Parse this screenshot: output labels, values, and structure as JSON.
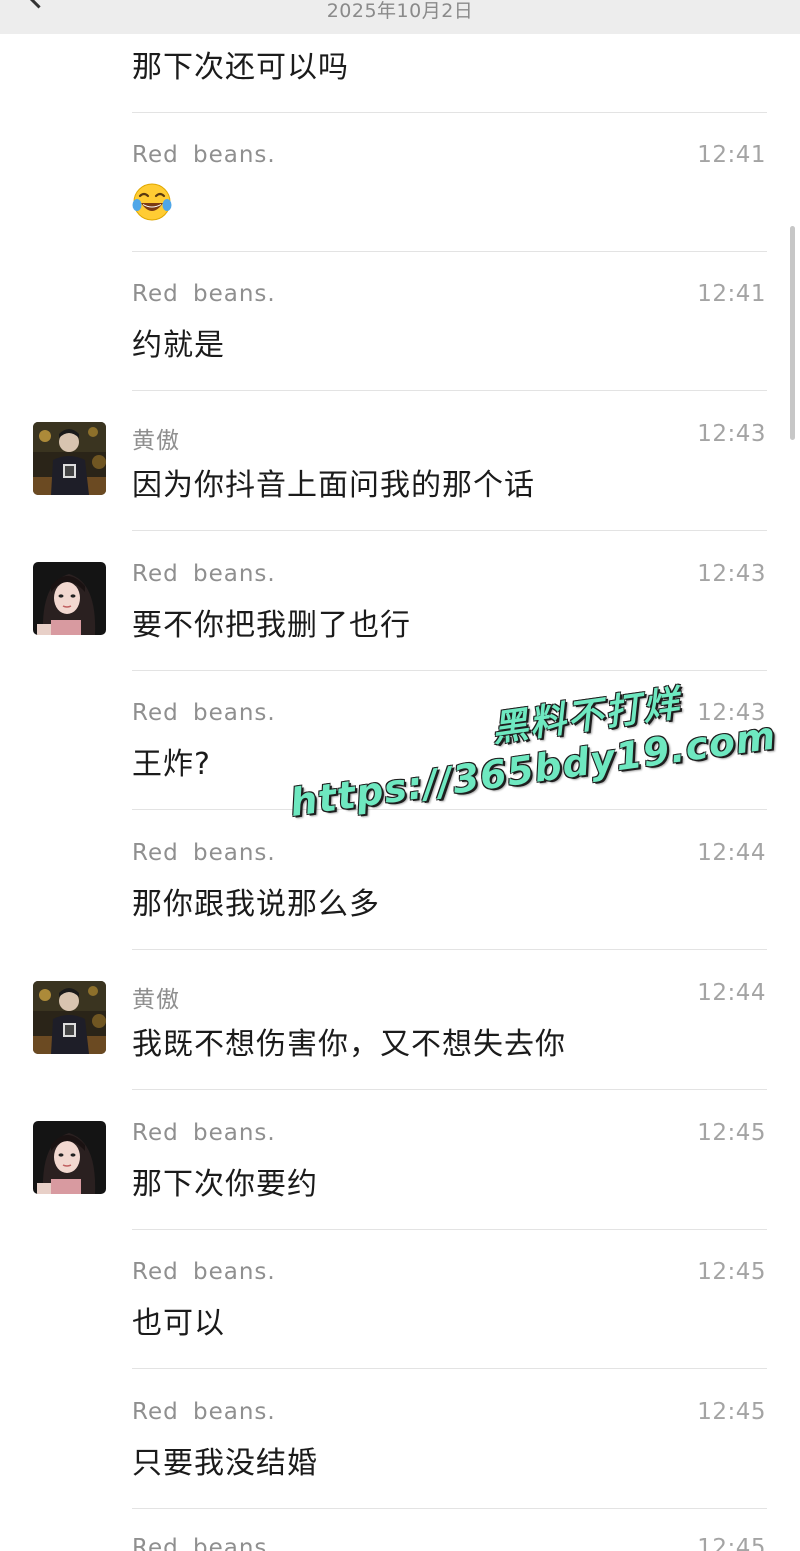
{
  "header": {
    "date": "2025年10月2日"
  },
  "messages": [
    {
      "sender": "",
      "time": "",
      "text": "那下次还可以吗",
      "avatar": ""
    },
    {
      "sender": "Red  beans.",
      "time": "12:41",
      "text": "",
      "emoji": "face-with-tears-of-joy",
      "avatar": ""
    },
    {
      "sender": "Red  beans.",
      "time": "12:41",
      "text": "约就是",
      "avatar": ""
    },
    {
      "sender": "黄傲",
      "time": "12:43",
      "text": "因为你抖音上面问我的那个话",
      "avatar": "male-avatar"
    },
    {
      "sender": "Red  beans.",
      "time": "12:43",
      "text": "要不你把我删了也行",
      "avatar": "female-avatar"
    },
    {
      "sender": "Red  beans.",
      "time": "12:43",
      "text": "王炸?",
      "avatar": ""
    },
    {
      "sender": "Red  beans.",
      "time": "12:44",
      "text": "那你跟我说那么多",
      "avatar": ""
    },
    {
      "sender": "黄傲",
      "time": "12:44",
      "text": "我既不想伤害你，又不想失去你",
      "avatar": "male-avatar"
    },
    {
      "sender": "Red  beans.",
      "time": "12:45",
      "text": "那下次你要约",
      "avatar": "female-avatar"
    },
    {
      "sender": "Red  beans.",
      "time": "12:45",
      "text": "也可以",
      "avatar": ""
    },
    {
      "sender": "Red  beans.",
      "time": "12:45",
      "text": "只要我没结婚",
      "avatar": ""
    },
    {
      "sender": "Red  beans.",
      "time": "12:45",
      "text": "",
      "avatar": ""
    }
  ],
  "watermark": {
    "line1": "黑料不打烊",
    "line2": "https://365bdy19.com"
  },
  "colors": {
    "header_bg": "#ededed",
    "watermark": "#6ee8c0"
  }
}
